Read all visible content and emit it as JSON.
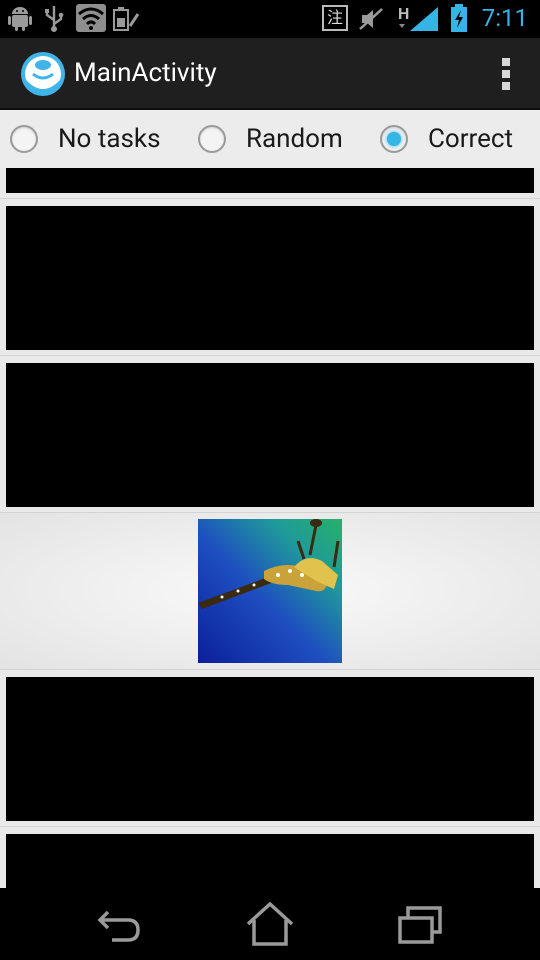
{
  "status_bar": {
    "time": "7:11",
    "icons_left": [
      "android-debug-icon",
      "usb-icon",
      "wifi-icon",
      "battery-saver-icon"
    ],
    "icons_right": [
      "ime-icon",
      "mute-icon",
      "hspa-signal-icon",
      "battery-charging-icon"
    ],
    "ime_glyph": "注",
    "network_label": "H",
    "accent_color": "#33b5e5"
  },
  "action_bar": {
    "title": "MainActivity",
    "app_icon": "app-launcher-icon",
    "menu_icon": "overflow-menu-icon"
  },
  "radio_group": {
    "options": [
      {
        "label": "No tasks",
        "checked": false
      },
      {
        "label": "Random",
        "checked": false
      },
      {
        "label": "Correct",
        "checked": true
      }
    ]
  },
  "list": {
    "items": [
      {
        "type": "placeholder"
      },
      {
        "type": "placeholder"
      },
      {
        "type": "placeholder"
      },
      {
        "type": "image",
        "image": "weedy-seadragon-photo"
      },
      {
        "type": "placeholder"
      },
      {
        "type": "placeholder"
      }
    ]
  },
  "nav_bar": {
    "buttons": [
      "back-icon",
      "home-icon",
      "recent-apps-icon"
    ]
  }
}
